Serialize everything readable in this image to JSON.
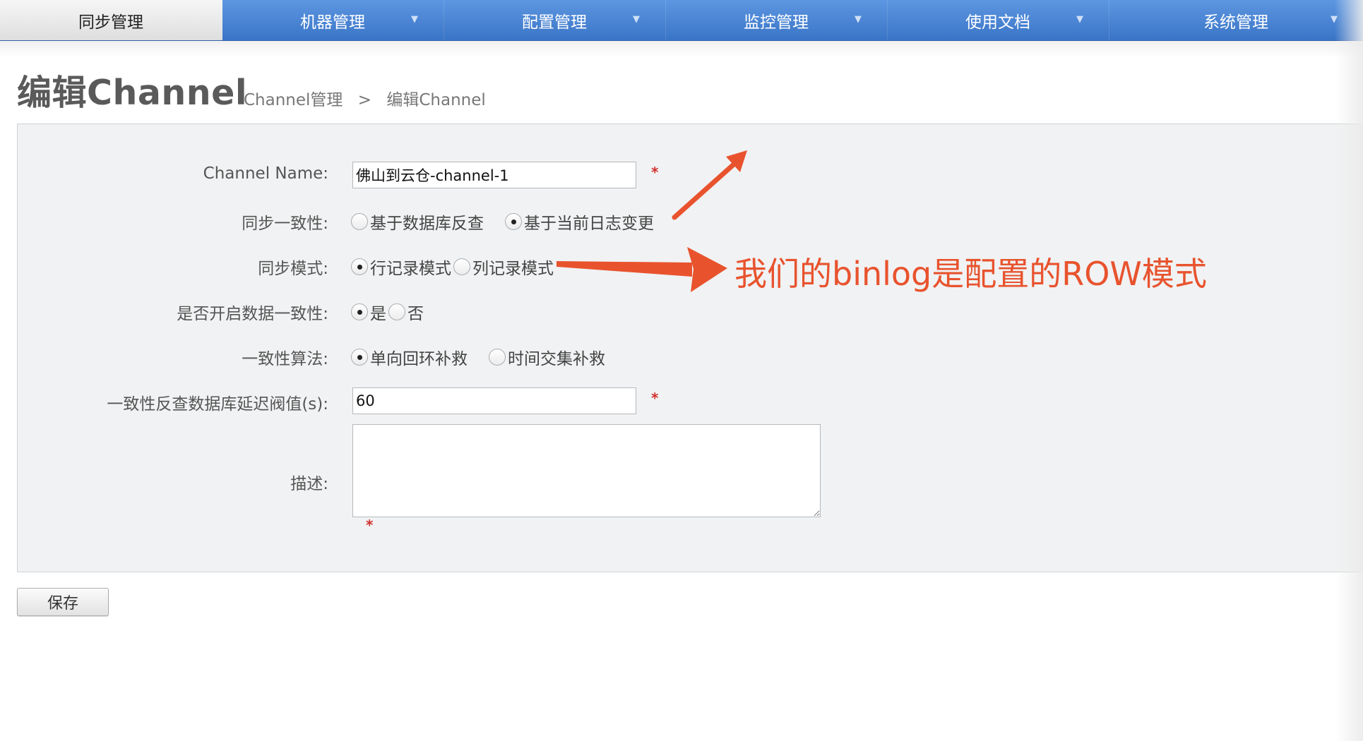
{
  "nav": {
    "items": [
      {
        "label": "同步管理",
        "active": true,
        "caret": ""
      },
      {
        "label": "机器管理",
        "active": false,
        "caret": "▼"
      },
      {
        "label": "配置管理",
        "active": false,
        "caret": "▼"
      },
      {
        "label": "监控管理",
        "active": false,
        "caret": "▼"
      },
      {
        "label": "使用文档",
        "active": false,
        "caret": "▼"
      },
      {
        "label": "系统管理",
        "active": false,
        "caret": "▼"
      }
    ]
  },
  "header": {
    "title": "编辑Channel",
    "breadcrumb": {
      "parent": "Channel管理",
      "separator": ">",
      "current": "编辑Channel"
    }
  },
  "form": {
    "channel_name": {
      "label": "Channel Name:",
      "value": "佛山到云仓-channel-1",
      "required_mark": "*"
    },
    "consistency": {
      "label": "同步一致性:",
      "options": [
        "基于数据库反查",
        "基于当前日志变更"
      ],
      "selected": 1
    },
    "sync_mode": {
      "label": "同步模式:",
      "options": [
        "行记录模式",
        "列记录模式"
      ],
      "selected": 0
    },
    "enable_consistency": {
      "label": "是否开启数据一致性:",
      "options": [
        "是",
        "否"
      ],
      "selected": 0
    },
    "algorithm": {
      "label": "一致性算法:",
      "options": [
        "单向回环补救",
        "时间交集补救"
      ],
      "selected": 0
    },
    "delay_threshold": {
      "label": "一致性反查数据库延迟阀值(s):",
      "value": "60",
      "required_mark": "*"
    },
    "description": {
      "label": "描述:",
      "value": "",
      "required_mark": "*"
    }
  },
  "actions": {
    "save_label": "保存"
  },
  "annotation": {
    "text": "我们的binlog是配置的ROW模式",
    "color": "#e8532e"
  }
}
